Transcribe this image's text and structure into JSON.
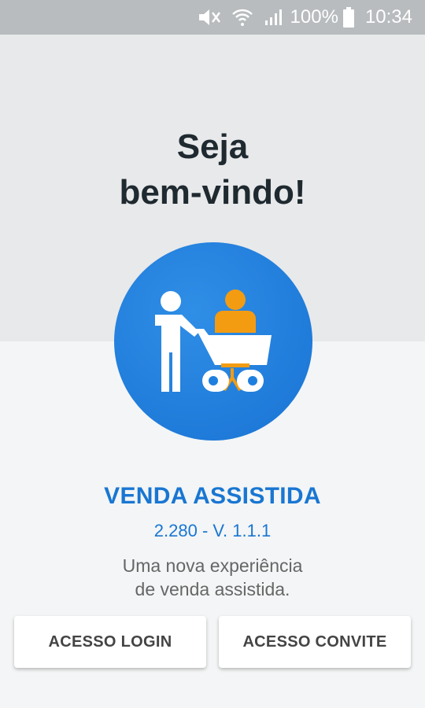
{
  "status_bar": {
    "battery_percent": "100%",
    "time": "10:34",
    "icons": [
      "mute-icon",
      "wifi-icon",
      "signal-icon",
      "battery-icon"
    ]
  },
  "welcome": {
    "line1": "Seja",
    "line2": "bem-vindo!"
  },
  "logo": {
    "icon": "shopping-cart-assist-icon",
    "colors": {
      "circle": "#1e7fdf",
      "person": "#ffffff",
      "seated_person": "#f39c12"
    }
  },
  "app": {
    "name": "VENDA ASSISTIDA",
    "version": "2.280 - V. 1.1.1",
    "tagline_line1": "Uma nova experiência",
    "tagline_line2": "de venda assistida."
  },
  "buttons": {
    "login": "ACESSO LOGIN",
    "convite": "ACESSO CONVITE"
  },
  "colors": {
    "accent": "#1976d2",
    "top_bg": "#e8e9ea",
    "bottom_bg": "#f3f5f6",
    "status_bar": "#b8bcbe"
  }
}
